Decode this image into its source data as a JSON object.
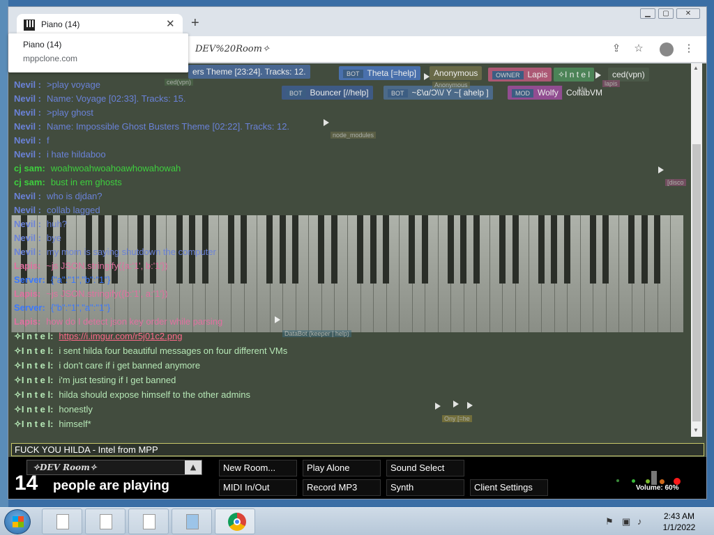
{
  "window": {
    "tab_title": "Piano (14)",
    "tooltip_title": "Piano (14)",
    "tooltip_url": "mppclone.com",
    "address": "DEV%20Room✧",
    "new_tab_glyph": "+",
    "close_glyph": "✕"
  },
  "names": [
    {
      "label": "ers Theme [23:24]. Tracks: 12.",
      "color": "#4a6a9a"
    },
    {
      "label": "Theta [=help]",
      "badge": "BOT",
      "color": "#4a74b8"
    },
    {
      "label": "Anonymous",
      "color": "#6e6e4a"
    },
    {
      "label": "Lapis",
      "badge": "OWNER",
      "color": "#b85a7a"
    },
    {
      "label": "✧I n t e l",
      "color": "#4e8a5a"
    },
    {
      "label": "ced(vpn)",
      "color": "#4c5a4a"
    },
    {
      "label": "Bouncer [//help]",
      "badge": "BOT",
      "color": "#3e5c8c"
    },
    {
      "label": "~Ɛ\\ɑ/Ɔ\\\\/ Y ~[ ahelp ]",
      "badge": "BOT",
      "color": "#4e6e92"
    },
    {
      "label": "Wolfy",
      "badge": "MOD",
      "color": "#9a4e9a"
    },
    {
      "label": "CollabVM",
      "color": "#424c3e"
    }
  ],
  "chat": [
    {
      "who": "Nevil :",
      "msg": ">play voyage",
      "who_color": "#6a82d8",
      "msg_color": "#6a82d8"
    },
    {
      "who": "Nevil :",
      "msg": "Name: Voyage [02:33]. Tracks: 15.",
      "who_color": "#6a82d8",
      "msg_color": "#6a82d8"
    },
    {
      "who": "Nevil :",
      "msg": ">play ghost",
      "who_color": "#6a82d8",
      "msg_color": "#6a82d8"
    },
    {
      "who": "Nevil :",
      "msg": "Name: Impossible Ghost Busters Theme [02:22]. Tracks: 12.",
      "who_color": "#6a82d8",
      "msg_color": "#6a82d8"
    },
    {
      "who": "Nevil :",
      "msg": "f",
      "who_color": "#6a82d8",
      "msg_color": "#6a82d8"
    },
    {
      "who": "Nevil :",
      "msg": "i hate hildaboo",
      "who_color": "#6a82d8",
      "msg_color": "#6a82d8"
    },
    {
      "who": "cj sam:",
      "msg": "woahwoahwoahoawhowahowah",
      "who_color": "#3ecf3e",
      "msg_color": "#3ecf3e"
    },
    {
      "who": "cj sam:",
      "msg": "bust in em ghosts",
      "who_color": "#3ecf3e",
      "msg_color": "#3ecf3e"
    },
    {
      "who": "Nevil :",
      "msg": "who is djdan?",
      "who_color": "#6a82d8",
      "msg_color": "#6a82d8"
    },
    {
      "who": "Nevil :",
      "msg": "collab lagged",
      "who_color": "#6a82d8",
      "msg_color": "#6a82d8"
    },
    {
      "who": "Nevil :",
      "msg": "huh?",
      "who_color": "#6a82d8",
      "msg_color": "#6a82d8"
    },
    {
      "who": "Nevil :",
      "msg": "bye",
      "who_color": "#6a82d8",
      "msg_color": "#6a82d8"
    },
    {
      "who": "Nevil :",
      "msg": "my mom is saying shutdown the computer",
      "who_color": "#6a82d8",
      "msg_color": "#6a82d8"
    },
    {
      "who": "Lapis:",
      "msg": "~js JSON.stringify({a:'1', b:'1'})",
      "who_color": "#e070a0",
      "msg_color": "#e070a0"
    },
    {
      "who": "Server:",
      "msg": "{\"a\":\"1\",\"b\":\"1\"}",
      "who_color": "#3a78ff",
      "msg_color": "#3a78ff"
    },
    {
      "who": "Lapis:",
      "msg": "~js JSON.stringify({b:'1', a:'1'})",
      "who_color": "#e070a0",
      "msg_color": "#e070a0"
    },
    {
      "who": "Server:",
      "msg": "{\"b\":\"1\",\"a\":\"1\"}",
      "who_color": "#3a78ff",
      "msg_color": "#3a78ff"
    },
    {
      "who": "Lapis:",
      "msg": "how do I detect json key order while parsing",
      "who_color": "#e070a0",
      "msg_color": "#e070a0"
    },
    {
      "who": "✧I n t e l:",
      "msg": "https://i.imgur.com/r5j01c2.png",
      "who_color": "#b6e8b6",
      "msg_color": "#ff6a8a",
      "link": true
    },
    {
      "who": "✧I n t e l:",
      "msg": "i sent hilda four beautiful messages on four different VMs",
      "who_color": "#b6e8b6",
      "msg_color": "#b6e8b6"
    },
    {
      "who": "✧I n t e l:",
      "msg": "i don't care if i get banned anymore",
      "who_color": "#b6e8b6",
      "msg_color": "#b6e8b6"
    },
    {
      "who": "✧I n t e l:",
      "msg": "i'm just testing if I get banned",
      "who_color": "#b6e8b6",
      "msg_color": "#b6e8b6"
    },
    {
      "who": "✧I n t e l:",
      "msg": "hilda should expose himself to the other admins",
      "who_color": "#b6e8b6",
      "msg_color": "#b6e8b6"
    },
    {
      "who": "✧I n t e l:",
      "msg": "honestly",
      "who_color": "#b6e8b6",
      "msg_color": "#b6e8b6"
    },
    {
      "who": "✧I n t e l:",
      "msg": "himself*",
      "who_color": "#b6e8b6",
      "msg_color": "#b6e8b6"
    }
  ],
  "chat_input": "FUCK YOU HILDA - Intel from MPP",
  "floating_labels": [
    "DataBot (keeper | help)",
    "node_modules",
    "[disco",
    "ced(vpn)",
    "Anonymous",
    "Me",
    "lapis",
    "Ony [=he"
  ],
  "bottom": {
    "room_name": "✧DEV Room✧",
    "count": "14",
    "count_label": "people are playing",
    "buttons": [
      "New Room...",
      "Play Alone",
      "Sound Select",
      "MIDI In/Out",
      "Record MP3",
      "Synth",
      "Client Settings"
    ],
    "volume": "Volume: 60%"
  },
  "taskbar": {
    "time": "2:43 AM",
    "date": "1/1/2022"
  },
  "colors": {
    "page_bg": "#424c3e",
    "nevil": "#6a82d8",
    "cjsam": "#3ecf3e",
    "lapis": "#e070a0",
    "server": "#3a78ff",
    "intel": "#b6e8b6"
  }
}
